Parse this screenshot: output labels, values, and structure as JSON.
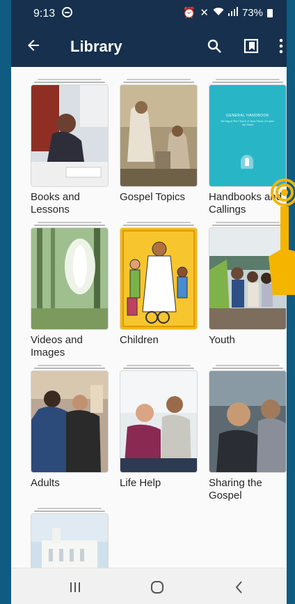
{
  "status_bar": {
    "time": "9:13",
    "battery": "73%",
    "icons": [
      "do-not-disturb-icon",
      "alarm-icon",
      "mute-icon",
      "wifi-icon",
      "signal-icon",
      "battery-icon"
    ]
  },
  "app_bar": {
    "title": "Library",
    "icons": [
      "back-arrow-icon",
      "search-icon",
      "bookmarks-icon",
      "more-vert-icon"
    ],
    "color": "#16304d"
  },
  "library": {
    "items": [
      {
        "label": "Books and\nLessons",
        "cover": "woman-studying-image"
      },
      {
        "label": "Gospel Topics",
        "cover": "woman-at-well-painting-image"
      },
      {
        "label": "Handbooks and\nCallings",
        "cover": "general-handbook-cover",
        "cover_title": "GENERAL HANDBOOK",
        "cover_subtitle": "Serving in The Church of Jesus Christ of Latter-day Saints",
        "cover_color": "#28b6c7"
      },
      {
        "label": "Videos and\nImages",
        "cover": "forest-light-image"
      },
      {
        "label": "Children",
        "cover": "jesus-with-children-illustration"
      },
      {
        "label": "Youth",
        "cover": "youth-group-beach-image"
      },
      {
        "label": "Adults",
        "cover": "adults-hugging-image"
      },
      {
        "label": "Life Help",
        "cover": "two-men-talking-image"
      },
      {
        "label": "Sharing the\nGospel",
        "cover": "smiling-friends-image"
      },
      {
        "label": "",
        "cover": "temple-image"
      }
    ]
  },
  "system_nav": {
    "icons": [
      "recent-apps-icon",
      "home-icon",
      "back-icon"
    ]
  },
  "overlay": {
    "icon": "tap-hand-icon",
    "color": "#f4b400"
  }
}
